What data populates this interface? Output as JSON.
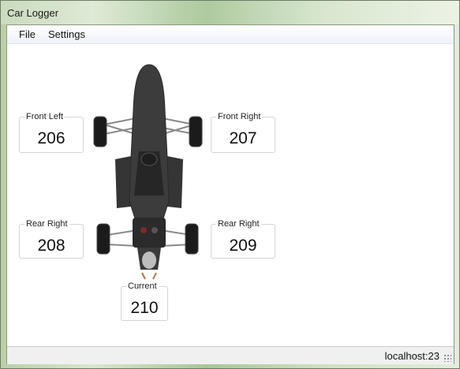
{
  "window": {
    "title": "Car Logger"
  },
  "menu": {
    "items": [
      "File",
      "Settings"
    ]
  },
  "gauges": {
    "front_left": {
      "label": "Front Left",
      "value": "206"
    },
    "front_right": {
      "label": "Front Right",
      "value": "207"
    },
    "rear_left": {
      "label": "Rear Right",
      "value": "208"
    },
    "rear_right": {
      "label": "Rear Right",
      "value": "209"
    },
    "current": {
      "label": "Current",
      "value": "210"
    }
  },
  "status": {
    "connection": "localhost:23"
  },
  "colors": {
    "car_body": "#3a3a3a",
    "tire": "#1b1b1b"
  }
}
